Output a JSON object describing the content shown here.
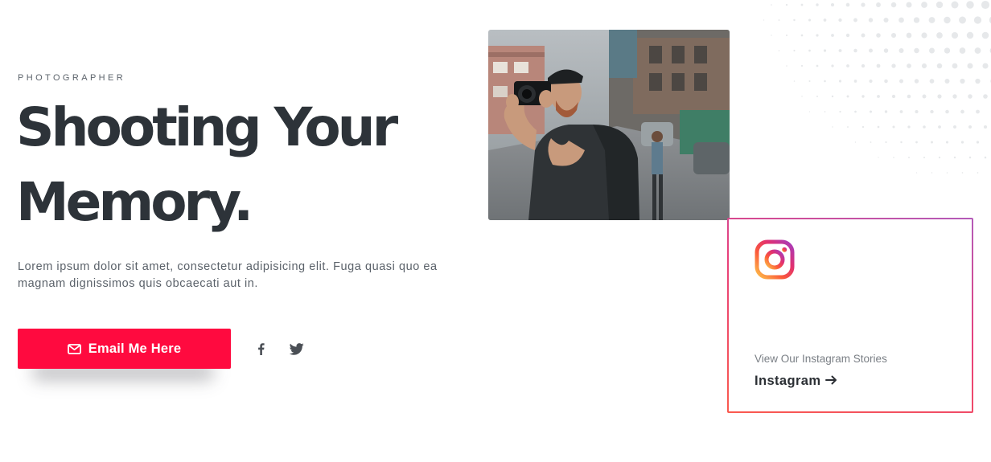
{
  "hero": {
    "eyebrow": "PHOTOGRAPHER",
    "headline": "Shooting Your Memory.",
    "description": "Lorem ipsum dolor sit amet, consectetur adipisicing elit. Fuga quasi quo ea magnam dignissimos quis obcaecati aut in.",
    "cta": {
      "label": "Email Me Here",
      "icon": "envelope-icon",
      "color": "#ff0a3f"
    },
    "social": [
      {
        "icon": "facebook-icon"
      },
      {
        "icon": "twitter-icon"
      }
    ]
  },
  "photo": {
    "subject": "photographer-with-camera"
  },
  "instagram_card": {
    "icon": "instagram-icon",
    "subtitle": "View Our Instagram Stories",
    "link_label": "Instagram",
    "link_icon": "arrow-right-icon",
    "border_colors": [
      "#fa5a4e",
      "#e8407b",
      "#b35bb9"
    ]
  },
  "colors": {
    "heading": "#2d3339",
    "body_text": "#5b626a",
    "accent": "#ff0a3f"
  }
}
